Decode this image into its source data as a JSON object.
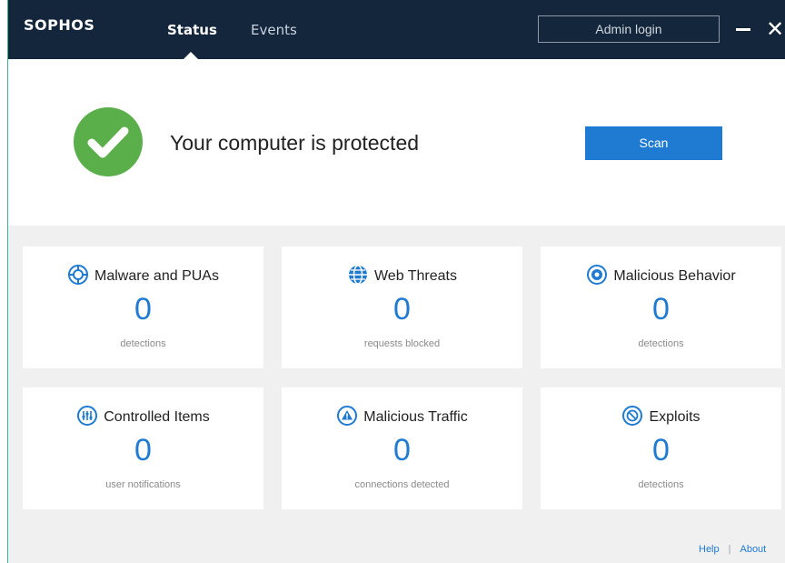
{
  "header": {
    "logo": "SOPHOS",
    "tabs": [
      {
        "label": "Status",
        "active": true
      },
      {
        "label": "Events",
        "active": false
      }
    ],
    "admin_login": "Admin login"
  },
  "status": {
    "message": "Your computer is protected",
    "scan_label": "Scan"
  },
  "cards": [
    {
      "title": "Malware and PUAs",
      "count": "0",
      "subtitle": "detections",
      "icon": "crosshair-icon"
    },
    {
      "title": "Web Threats",
      "count": "0",
      "subtitle": "requests blocked",
      "icon": "globe-icon"
    },
    {
      "title": "Malicious Behavior",
      "count": "0",
      "subtitle": "detections",
      "icon": "target-icon"
    },
    {
      "title": "Controlled Items",
      "count": "0",
      "subtitle": "user notifications",
      "icon": "sliders-icon"
    },
    {
      "title": "Malicious Traffic",
      "count": "0",
      "subtitle": "connections detected",
      "icon": "warning-icon"
    },
    {
      "title": "Exploits",
      "count": "0",
      "subtitle": "detections",
      "icon": "blocked-icon"
    }
  ],
  "footer": {
    "help": "Help",
    "separator": "|",
    "about": "About"
  },
  "colors": {
    "header_bg": "#14263b",
    "accent_blue": "#1f7ad1",
    "success_green": "#5aaf4a"
  }
}
